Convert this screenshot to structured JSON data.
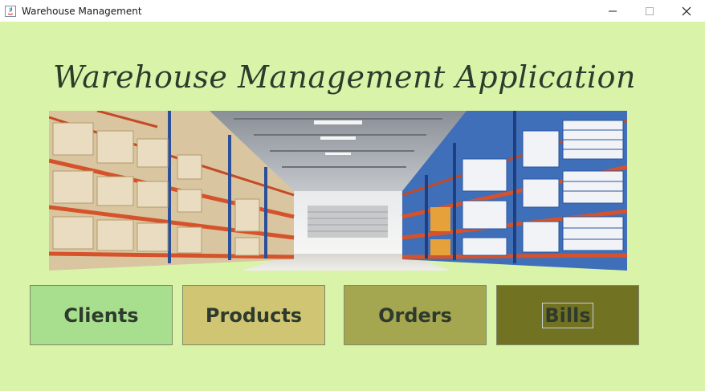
{
  "window": {
    "title": "Warehouse Management",
    "controls": {
      "minimize": "minimize-icon",
      "maximize": "maximize-icon",
      "close": "close-icon"
    }
  },
  "app": {
    "heading": "Warehouse Management Application",
    "banner_image": "warehouse-shelves-photo"
  },
  "buttons": [
    {
      "label": "Clients",
      "color": "#a8df8e"
    },
    {
      "label": "Products",
      "color": "#cfc572"
    },
    {
      "label": "Orders",
      "color": "#a5a650"
    },
    {
      "label": "Bills",
      "color": "#727223",
      "focused": true
    }
  ],
  "colors": {
    "background": "#d9f3a9",
    "heading": "#2d3b2d"
  }
}
